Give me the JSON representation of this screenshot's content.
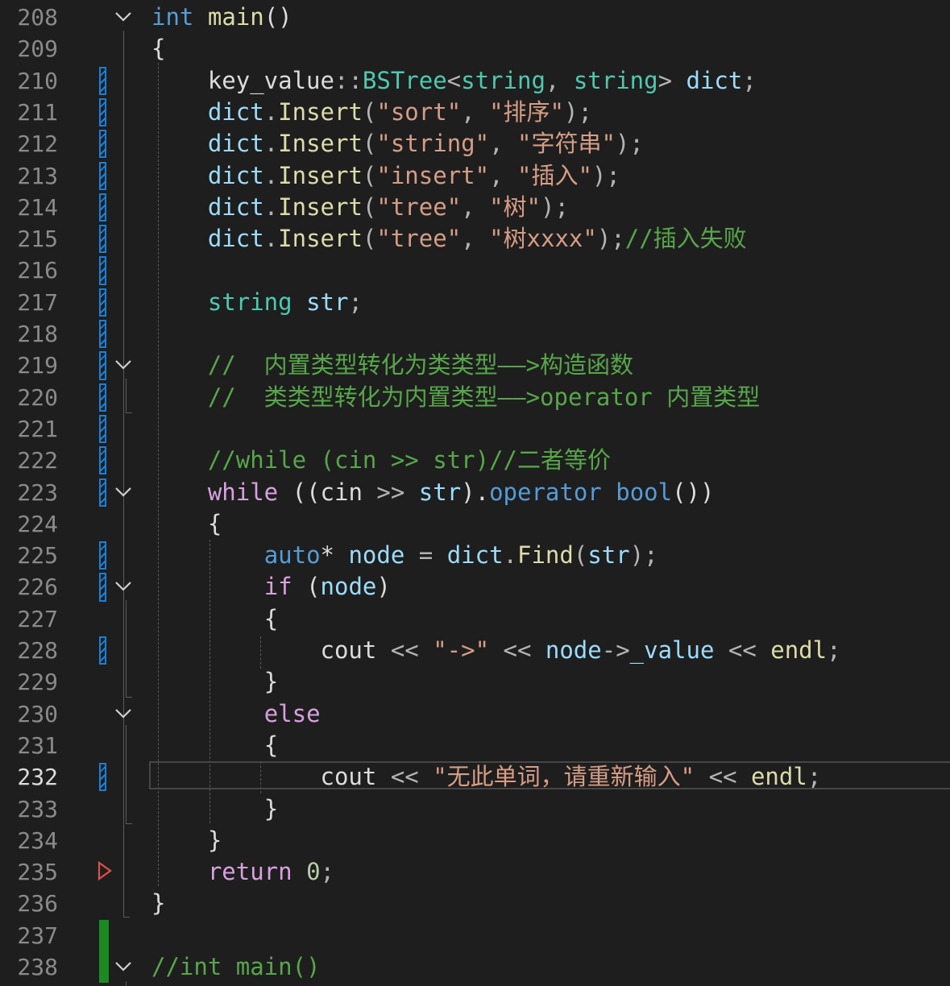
{
  "editor": {
    "current_line": "232",
    "line_numbers": [
      "208",
      "209",
      "210",
      "211",
      "212",
      "213",
      "214",
      "215",
      "216",
      "217",
      "218",
      "219",
      "220",
      "221",
      "222",
      "223",
      "224",
      "225",
      "226",
      "227",
      "228",
      "229",
      "230",
      "231",
      "232",
      "233",
      "234",
      "235",
      "236",
      "237",
      "238"
    ],
    "fold_icon": "chevron-down-icon",
    "breakpoint_icon": "breakpoint-outline-icon",
    "colors": {
      "background": "#1e1e1e",
      "keyword": "#569cd6",
      "control": "#d8a0df",
      "type": "#4ec9b0",
      "function": "#dcdcaa",
      "variable": "#9cdcfe",
      "string": "#d69d85",
      "comment": "#57a64a",
      "changed_marker": "#1c7fd6",
      "added_marker": "#1b8a23"
    }
  },
  "code": {
    "l208": [
      "int",
      "main",
      "()"
    ],
    "l209": [
      "{"
    ],
    "l210": [
      "key_value",
      "::",
      "BSTree",
      "<",
      "string",
      ", ",
      "string",
      "> ",
      "dict",
      ";"
    ],
    "l211": [
      "dict",
      ".",
      "Insert",
      "(",
      "\"sort\"",
      ", ",
      "\"排序\"",
      ");"
    ],
    "l212": [
      "dict",
      ".",
      "Insert",
      "(",
      "\"string\"",
      ", ",
      "\"字符串\"",
      ");"
    ],
    "l213": [
      "dict",
      ".",
      "Insert",
      "(",
      "\"insert\"",
      ", ",
      "\"插入\"",
      ");"
    ],
    "l214": [
      "dict",
      ".",
      "Insert",
      "(",
      "\"tree\"",
      ", ",
      "\"树\"",
      ");"
    ],
    "l215": [
      "dict",
      ".",
      "Insert",
      "(",
      "\"tree\"",
      ", ",
      "\"树xxxx\"",
      ");",
      "//插入失败"
    ],
    "l217": [
      "string",
      "str",
      ";"
    ],
    "l219": [
      "//  内置类型转化为类类型——>构造函数"
    ],
    "l220": [
      "//  类类型转化为内置类型——>operator 内置类型"
    ],
    "l222": [
      "//while (cin >> str)//二者等价"
    ],
    "l223": [
      "while",
      " ((",
      "cin",
      " >> ",
      "str",
      ").",
      "operator",
      " ",
      "bool",
      "())"
    ],
    "l224": [
      "{"
    ],
    "l225": [
      "auto",
      "* ",
      "node",
      " = ",
      "dict",
      ".",
      "Find",
      "(",
      "str",
      ");"
    ],
    "l226": [
      "if",
      " (",
      "node",
      ")"
    ],
    "l227": [
      "{"
    ],
    "l228": [
      "cout",
      " << ",
      "\"->\"",
      " << ",
      "node",
      "->",
      "_value",
      " << ",
      "endl",
      ";"
    ],
    "l229": [
      "}"
    ],
    "l230": [
      "else"
    ],
    "l231": [
      "{"
    ],
    "l232": [
      "cout",
      " << ",
      "\"无此单词，请重新输入\"",
      " << ",
      "endl",
      ";"
    ],
    "l233": [
      "}"
    ],
    "l234": [
      "}"
    ],
    "l235": [
      "return",
      " ",
      "0",
      ";"
    ],
    "l236": [
      "}"
    ],
    "l238": [
      "//int main()"
    ]
  }
}
